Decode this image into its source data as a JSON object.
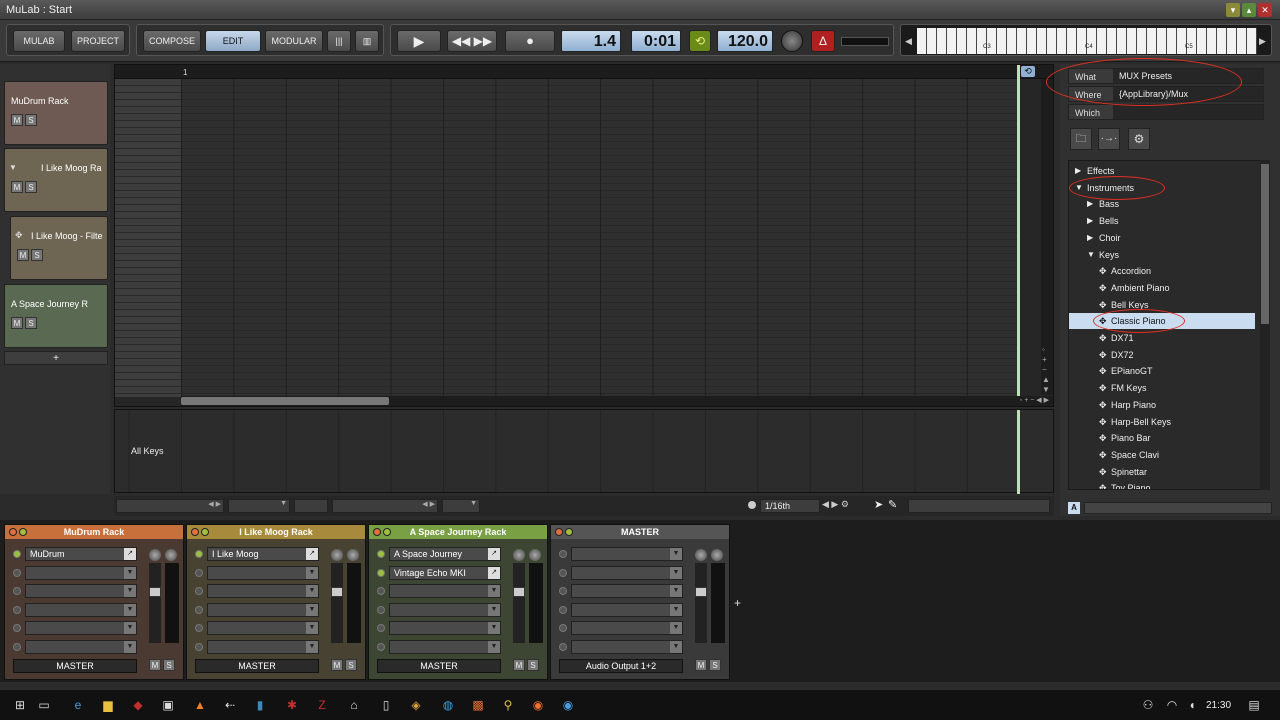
{
  "window": {
    "title": "MuLab : Start"
  },
  "toolbar": {
    "mulab": "MULAB",
    "project": "PROJECT",
    "compose": "COMPOSE",
    "edit": "EDIT",
    "modular": "MODULAR",
    "position": "1.4",
    "time": "0:01",
    "tempo": "120.0"
  },
  "keyboard": {
    "labels": [
      "C3",
      "C4",
      "C5"
    ]
  },
  "tracks": [
    {
      "name": "MuDrum Rack",
      "color": "#6e5a52"
    },
    {
      "name": "I Like Moog Ra",
      "color": "#6e6652"
    },
    {
      "name": "I Like Moog - Filte",
      "color": "#6e6652"
    },
    {
      "name": "A Space Journey R",
      "color": "#5a6a52"
    }
  ],
  "track_ms": {
    "m": "M",
    "s": "S"
  },
  "add_track": "+",
  "editor": {
    "ruler_mark": "1",
    "lower_label": "All Keys",
    "quantize": "1/16th"
  },
  "browser": {
    "what_label": "What",
    "what_value": "MUX Presets",
    "where_label": "Where",
    "where_value": "{AppLibrary}/Mux",
    "which_label": "Which",
    "which_value": "",
    "tree": [
      {
        "label": "Effects",
        "level": 0,
        "type": "collapsed"
      },
      {
        "label": "Instruments",
        "level": 0,
        "type": "expanded"
      },
      {
        "label": "Bass",
        "level": 1,
        "type": "collapsed"
      },
      {
        "label": "Bells",
        "level": 1,
        "type": "collapsed"
      },
      {
        "label": "Choir",
        "level": 1,
        "type": "collapsed"
      },
      {
        "label": "Keys",
        "level": 1,
        "type": "expanded"
      },
      {
        "label": "Accordion",
        "level": 2,
        "type": "preset"
      },
      {
        "label": "Ambient Piano",
        "level": 2,
        "type": "preset"
      },
      {
        "label": "Bell Keys",
        "level": 2,
        "type": "preset"
      },
      {
        "label": "Classic Piano",
        "level": 2,
        "type": "preset",
        "selected": true
      },
      {
        "label": "DX71",
        "level": 2,
        "type": "preset"
      },
      {
        "label": "DX72",
        "level": 2,
        "type": "preset"
      },
      {
        "label": "EPianoGT",
        "level": 2,
        "type": "preset"
      },
      {
        "label": "FM Keys",
        "level": 2,
        "type": "preset"
      },
      {
        "label": "Harp Piano",
        "level": 2,
        "type": "preset"
      },
      {
        "label": "Harp-Bell Keys",
        "level": 2,
        "type": "preset"
      },
      {
        "label": "Piano Bar",
        "level": 2,
        "type": "preset"
      },
      {
        "label": "Space Clavi",
        "level": 2,
        "type": "preset"
      },
      {
        "label": "Spinettar",
        "level": 2,
        "type": "preset"
      },
      {
        "label": "Toy Piano",
        "level": 2,
        "type": "preset"
      }
    ],
    "footer_letter": "A"
  },
  "mixer": {
    "strips": [
      {
        "name": "MuDrum Rack",
        "color": "#c8703c",
        "bg": "#4a3a32",
        "slots": [
          "MuDrum",
          "",
          "",
          "",
          "",
          ""
        ],
        "output": "MASTER"
      },
      {
        "name": "I Like Moog Rack",
        "color": "#a88a3c",
        "bg": "#484232",
        "slots": [
          "I Like Moog",
          "",
          "",
          "",
          "",
          ""
        ],
        "output": "MASTER"
      },
      {
        "name": "A Space Journey Rack",
        "color": "#7aa044",
        "bg": "#3c4632",
        "slots": [
          "A Space Journey",
          "Vintage Echo MKI",
          "",
          "",
          "",
          ""
        ],
        "output": "MASTER"
      },
      {
        "name": "MASTER",
        "color": "#555555",
        "bg": "#3a3a3a",
        "slots": [
          "",
          "",
          "",
          "",
          "",
          ""
        ],
        "output": "Audio Output 1+2"
      }
    ],
    "add": "+"
  },
  "taskbar": {
    "clock": "21:30"
  }
}
